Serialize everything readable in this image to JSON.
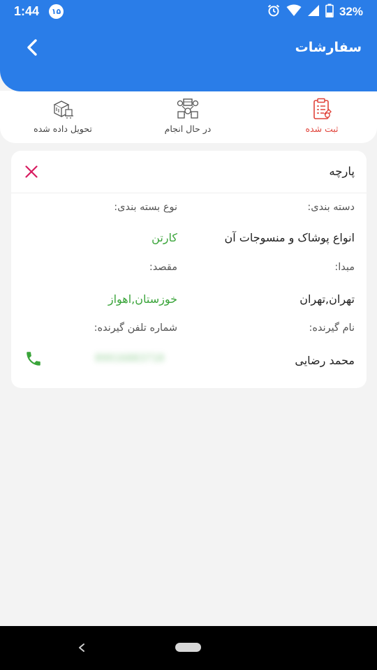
{
  "status_bar": {
    "time": "1:44",
    "badge": "۱۵",
    "battery": "32%",
    "icons": [
      "alarm-icon",
      "wifi-icon",
      "signal-icon",
      "battery-icon"
    ]
  },
  "app_bar": {
    "title": "سفارشات",
    "back_icon": "chevron-left-icon",
    "color": "#2a7de8"
  },
  "tabs": [
    {
      "label": "ثبت شده",
      "icon": "clipboard-icon",
      "active": true
    },
    {
      "label": "در حال انجام",
      "icon": "processing-icon",
      "active": false
    },
    {
      "label": "تحویل داده شده",
      "icon": "delivered-boxes-icon",
      "active": false
    }
  ],
  "order": {
    "title": "پارچه",
    "category_label": "دسته بندی:",
    "category_value": "انواع پوشاک و منسوجات آن",
    "packaging_label": "نوع بسته بندی:",
    "packaging_value": "کارتن",
    "origin_label": "مبدا:",
    "origin_value": "تهران,تهران",
    "destination_label": "مقصد:",
    "destination_value": "خوزستان,اهواز",
    "receiver_label": "نام گیرنده:",
    "receiver_value": "محمد رضایی",
    "receiver_phone_label": "شماره تلفن گیرنده:",
    "receiver_phone_value": "09916883710"
  },
  "colors": {
    "accent": "#2a7de8",
    "active_tab": "#e0433a",
    "value_green": "#3aa43a",
    "close_x": "#d81b60"
  }
}
